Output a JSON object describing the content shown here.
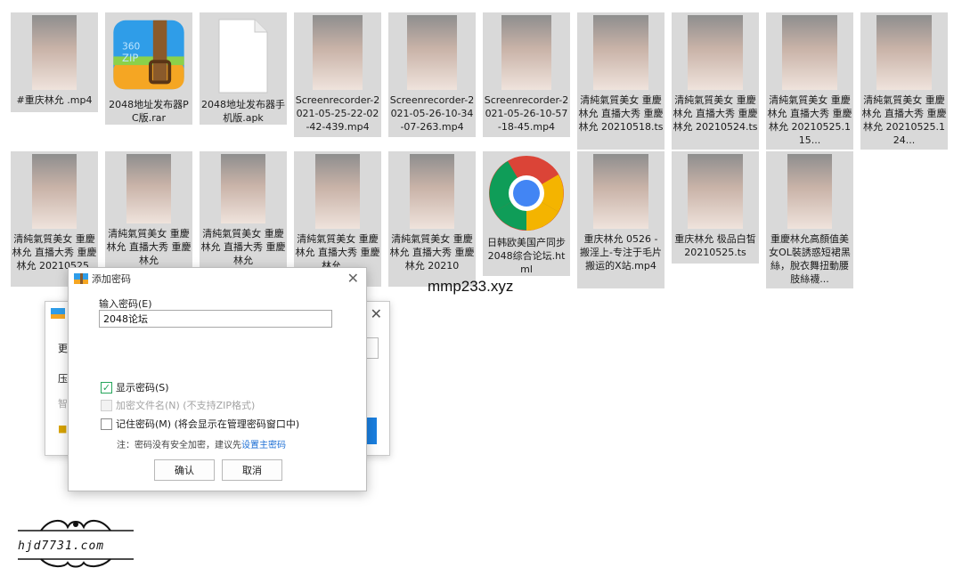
{
  "files_row1": [
    {
      "name": "#重庆林允 .mp4",
      "icon": "video-thumbnail"
    },
    {
      "name": "2048地址发布器PC版.rar",
      "icon": "zip-icon"
    },
    {
      "name": "2048地址发布器手机版.apk",
      "icon": "blank-file-icon"
    },
    {
      "name": "Screenrecorder-2021-05-25-22-02-42-439.mp4",
      "icon": "video-thumbnail"
    },
    {
      "name": "Screenrecorder-2021-05-26-10-34-07-263.mp4",
      "icon": "video-thumbnail"
    },
    {
      "name": "Screenrecorder-2021-05-26-10-57-18-45.mp4",
      "icon": "video-thumbnail"
    },
    {
      "name": "清純氣質美女 重慶林允 直播大秀 重慶林允 20210518.ts",
      "icon": "video-thumbnail"
    },
    {
      "name": "清純氣質美女 重慶林允 直播大秀 重慶林允 20210524.ts",
      "icon": "video-thumbnail"
    },
    {
      "name": "清純氣質美女 重慶林允 直播大秀 重慶林允 20210525.115...",
      "icon": "video-thumbnail"
    },
    {
      "name": "清純氣質美女 重慶林允 直播大秀 重慶林允 20210525.124...",
      "icon": "video-thumbnail"
    }
  ],
  "files_row2": [
    {
      "name": "清純氣質美女 重慶林允 直播大秀 重慶林允 20210525.",
      "icon": "video-thumbnail"
    },
    {
      "name": "清純氣質美女 重慶林允 直播大秀 重慶林允",
      "icon": "video-thumbnail"
    },
    {
      "name": "清純氣質美女 重慶林允 直播大秀 重慶林允",
      "icon": "video-thumbnail"
    },
    {
      "name": "清純氣質美女 重慶林允 直播大秀 重慶林允 ...",
      "icon": "video-thumbnail"
    },
    {
      "name": "清純氣質美女 重慶林允 直播大秀 重慶林允 20210",
      "icon": "video-thumbnail"
    },
    {
      "name": "日韩欧美国产同步 2048综合论坛.html",
      "icon": "chrome-icon"
    },
    {
      "name": "重庆林允 0526 - 搬淫上-专注于毛片搬运的X站.mp4",
      "icon": "video-thumbnail"
    },
    {
      "name": "重庆林允 极品白皙 20210525.ts",
      "icon": "video-thumbnail"
    },
    {
      "name": "重慶林允高顏值美女OL裝誘惑短裙黑絲，脫衣舞扭動腰肢絲襪...",
      "icon": "video-thumbnail"
    }
  ],
  "dialog": {
    "title": "添加密码",
    "input_label": "输入密码(E)",
    "input_value": "2048论坛",
    "show_password_label": "显示密码(S)",
    "encrypt_names_label": "加密文件名(N) (不支持ZIP格式)",
    "remember_label": "记住密码(M) (将会显示在管理密码窗口中)",
    "note_text": "注：密码没有安全加密，建议先",
    "note_link": "设置主密码",
    "ok_label": "确认",
    "cancel_label": "取消",
    "close_glyph": "✕"
  },
  "back_dialog": {
    "close_glyph": "✕",
    "peek_1": "更",
    "peek_2": "压",
    "peek_3": "智"
  },
  "watermarks": {
    "url_center": "mmp233.xyz",
    "logo_text": "hjd7731.com"
  },
  "colors": {
    "accent_blue": "#1d6fd4",
    "check_green": "#26a65b",
    "tile_bg": "#d9d9d9"
  }
}
